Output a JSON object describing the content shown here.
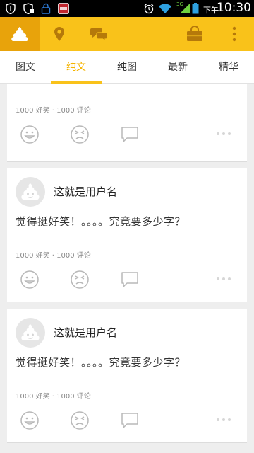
{
  "statusbar": {
    "ampm": "下午",
    "time": "10:30",
    "icons": [
      "shield-icon",
      "shield-lock-icon",
      "lock-icon",
      "red-app-icon",
      "alarm-icon",
      "wifi-icon",
      "signal-icon",
      "battery-icon"
    ],
    "network_label": "3G"
  },
  "appbar": {
    "icons": [
      "poop-home-icon",
      "location-pin-icon",
      "chat-bubbles-icon",
      "shopping-bag-icon",
      "more-vertical-icon"
    ],
    "brand_color": "#f9c21a",
    "active_bg": "#e8a30b"
  },
  "tabs": {
    "items": [
      "图文",
      "纯文",
      "纯图",
      "最新",
      "精华"
    ],
    "active": "纯文",
    "accent": "#f5b400"
  },
  "cards": [
    {
      "partial": true,
      "stats": "1000 好笑 · 1000 评论"
    },
    {
      "username": "这就是用户名",
      "content": "觉得挺好笑！。。。。究竟要多少字？",
      "stats": "1000 好笑 · 1000 评论"
    },
    {
      "username": "这就是用户名",
      "content": "觉得挺好笑！。。。。究竟要多少字？",
      "stats": "1000 好笑 · 1000 评论"
    }
  ],
  "card_actions": [
    "smile-icon",
    "dislike-face-icon",
    "comment-icon",
    "more-dots-icon"
  ]
}
